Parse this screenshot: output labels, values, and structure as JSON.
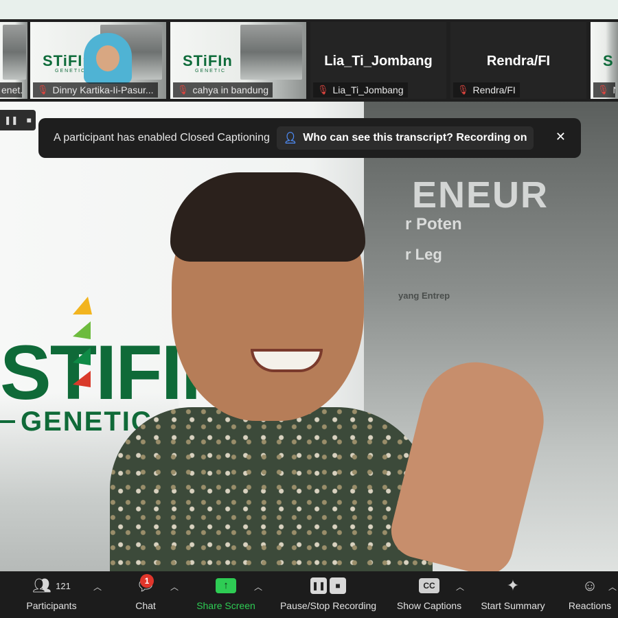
{
  "participants_strip": [
    {
      "label": "enet...",
      "kind": "video-partial"
    },
    {
      "label": "Dinny Kartika-Ii-Pasur...",
      "kind": "video",
      "logo": "STiFIn",
      "logo_sub": "GENETIC"
    },
    {
      "label": "cahya in bandung",
      "kind": "video",
      "logo": "STiFIn",
      "logo_sub": "GENETIC"
    },
    {
      "label": "Lia_Ti_Jombang",
      "kind": "name",
      "name": "Lia_Ti_Jombang"
    },
    {
      "label": "Rendra/FI",
      "kind": "name",
      "name": "Rendra/FI"
    },
    {
      "label": "N",
      "kind": "video-partial",
      "logo": "S"
    }
  ],
  "stage": {
    "logo_main": "STIFIN",
    "logo_sub": "GENETIC",
    "poster_line1": "ENEUR",
    "poster_line2": "r Poten",
    "poster_line3": "r Leg",
    "poster_line4": "yang Entrep"
  },
  "caption_banner": {
    "message": "A participant has enabled Closed Captioning",
    "link_text": "Who can see this transcript? Recording on",
    "close_glyph": "✕"
  },
  "mini_controls": {
    "pause_glyph": "❚❚",
    "stop_glyph": "■"
  },
  "toolbar": {
    "participants": {
      "label": "Participants",
      "count": "121"
    },
    "chat": {
      "label": "Chat",
      "badge": "1"
    },
    "share_screen": {
      "label": "Share Screen"
    },
    "recording": {
      "label": "Pause/Stop Recording"
    },
    "captions": {
      "label": "Show Captions",
      "icon_text": "CC"
    },
    "summary": {
      "label": "Start Summary"
    },
    "reactions": {
      "label": "Reactions"
    }
  },
  "colors": {
    "brand_green": "#0f6a38",
    "share_green": "#2ecc54",
    "badge_red": "#e0352b",
    "mic_off_red": "#e0453f"
  }
}
